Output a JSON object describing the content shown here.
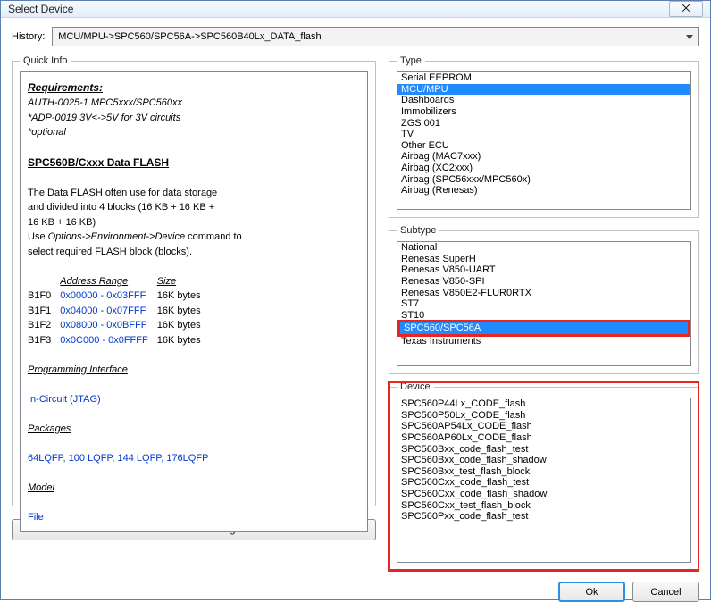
{
  "window": {
    "title": "Select Device",
    "close_glyph": "⨉"
  },
  "history": {
    "label": "History:",
    "value": "MCU/MPU->SPC560/SPC56A->SPC560B40Lx_DATA_flash"
  },
  "quickinfo": {
    "legend": "Quick Info",
    "requirements_hdr": "Requirements:",
    "req_line1": "AUTH-0025-1 MPC5xxx/SPC560xx",
    "req_line2": "*ADP-0019 3V<->5V for 3V circuits",
    "req_optional": "*optional",
    "title2": "SPC560B/Cxxx Data FLASH",
    "desc1": "The Data FLASH often use for data storage",
    "desc2": "and divided into 4 blocks (16 KB + 16 KB +",
    "desc3": "16 KB + 16 KB)",
    "desc4_a": "Use ",
    "desc4_b": "Options->Environment->Device",
    "desc4_c": " command to",
    "desc5": "select required FLASH block (blocks).",
    "tbl": {
      "h_addr": "Address Range",
      "h_size": "Size",
      "rows": [
        {
          "blk": "B1F0",
          "range": "0x00000 - 0x03FFF",
          "size": "16K bytes"
        },
        {
          "blk": "B1F1",
          "range": "0x04000 - 0x07FFF",
          "size": "16K bytes"
        },
        {
          "blk": "B1F2",
          "range": "0x08000 - 0x0BFFF",
          "size": "16K bytes"
        },
        {
          "blk": "B1F3",
          "range": "0x0C000 - 0x0FFFF",
          "size": "16K bytes"
        }
      ]
    },
    "prog_if_hdr": "Programming Interface",
    "prog_if": "In-Circuit (JTAG)",
    "packages_hdr": "Packages",
    "packages": "64LQFP, 100 LQFP, 144 LQFP, 176LQFP",
    "model_hdr": "Model",
    "model": "File",
    "btn_diagram": "Show Connection Diagram"
  },
  "type": {
    "legend": "Type",
    "items": [
      "Serial EEPROM",
      "MCU/MPU",
      "Dashboards",
      "Immobilizers",
      "ZGS 001",
      "TV",
      "Other ECU",
      "Airbag (MAC7xxx)",
      "Airbag (XC2xxx)",
      "Airbag (SPC56xxx/MPC560x)",
      "Airbag (Renesas)"
    ],
    "selected": "MCU/MPU"
  },
  "subtype": {
    "legend": "Subtype",
    "items": [
      "National",
      "Renesas SuperH",
      "Renesas V850-UART",
      "Renesas V850-SPI",
      "Renesas V850E2-FLUR0RTX",
      "ST7",
      "ST10",
      "SPC560/SPC56A",
      "Texas Instruments"
    ],
    "selected": "SPC560/SPC56A"
  },
  "device": {
    "legend": "Device",
    "items": [
      "SPC560P44Lx_CODE_flash",
      "SPC560P50Lx_CODE_flash",
      "SPC560AP54Lx_CODE_flash",
      "SPC560AP60Lx_CODE_flash",
      "SPC560Bxx_code_flash_test",
      "SPC560Bxx_code_flash_shadow",
      "SPC560Bxx_test_flash_block",
      "SPC560Cxx_code_flash_test",
      "SPC560Cxx_code_flash_shadow",
      "SPC560Cxx_test_flash_block",
      "SPC560Pxx_code_flash_test"
    ]
  },
  "buttons": {
    "ok": "Ok",
    "cancel": "Cancel"
  }
}
